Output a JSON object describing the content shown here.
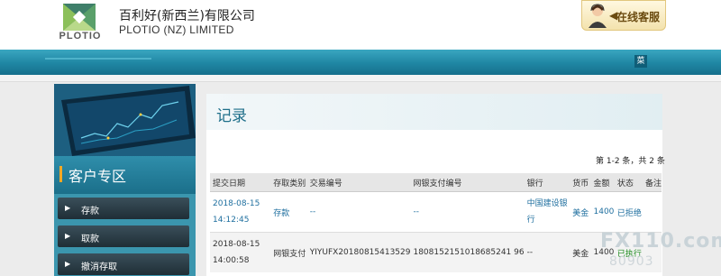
{
  "brand": {
    "logo_text": "PLOTIO",
    "company_cn": "百利好(新西兰)有限公司",
    "company_en": "PLOTIO (NZ) LIMITED",
    "colors": {
      "primary": "#1f86a3",
      "accent": "#f6a823",
      "link": "#1f6f9f",
      "success": "#1a8a1a"
    }
  },
  "service": {
    "label": "在线客服",
    "icon": "headset-agent-icon"
  },
  "nav": {
    "menu_label": "菜"
  },
  "sidebar": {
    "title": "客户专区",
    "items": [
      {
        "label": "存款"
      },
      {
        "label": "取款"
      },
      {
        "label": "撤消存取"
      }
    ]
  },
  "main": {
    "title": "记录",
    "count_text": "第 1-2 条，共 2 条",
    "columns": [
      "提交日期",
      "存取类别",
      "交易编号",
      "网银支付编号",
      "银行",
      "货币",
      "金额",
      "状态",
      "备注"
    ],
    "rows": [
      {
        "date": "2018-08-15",
        "time": "14:12:45",
        "type": "存款",
        "txn": "--",
        "pay_no": "--",
        "bank_line1": "中国建设银",
        "bank_line2": "行",
        "currency": "美金",
        "amount": "1400",
        "status": "已拒绝",
        "note": ""
      },
      {
        "date": "2018-08-15",
        "time": "14:00:58",
        "type": "网银支付",
        "txn": "YIYUFX20180815413529",
        "pay_no": "1808152151018685241 96",
        "bank_line1": "--",
        "bank_line2": "",
        "currency": "美金",
        "amount": "1400",
        "status": "已执行",
        "note": ""
      }
    ]
  },
  "watermark": {
    "line1": "FX110.com",
    "line2": "80903"
  }
}
